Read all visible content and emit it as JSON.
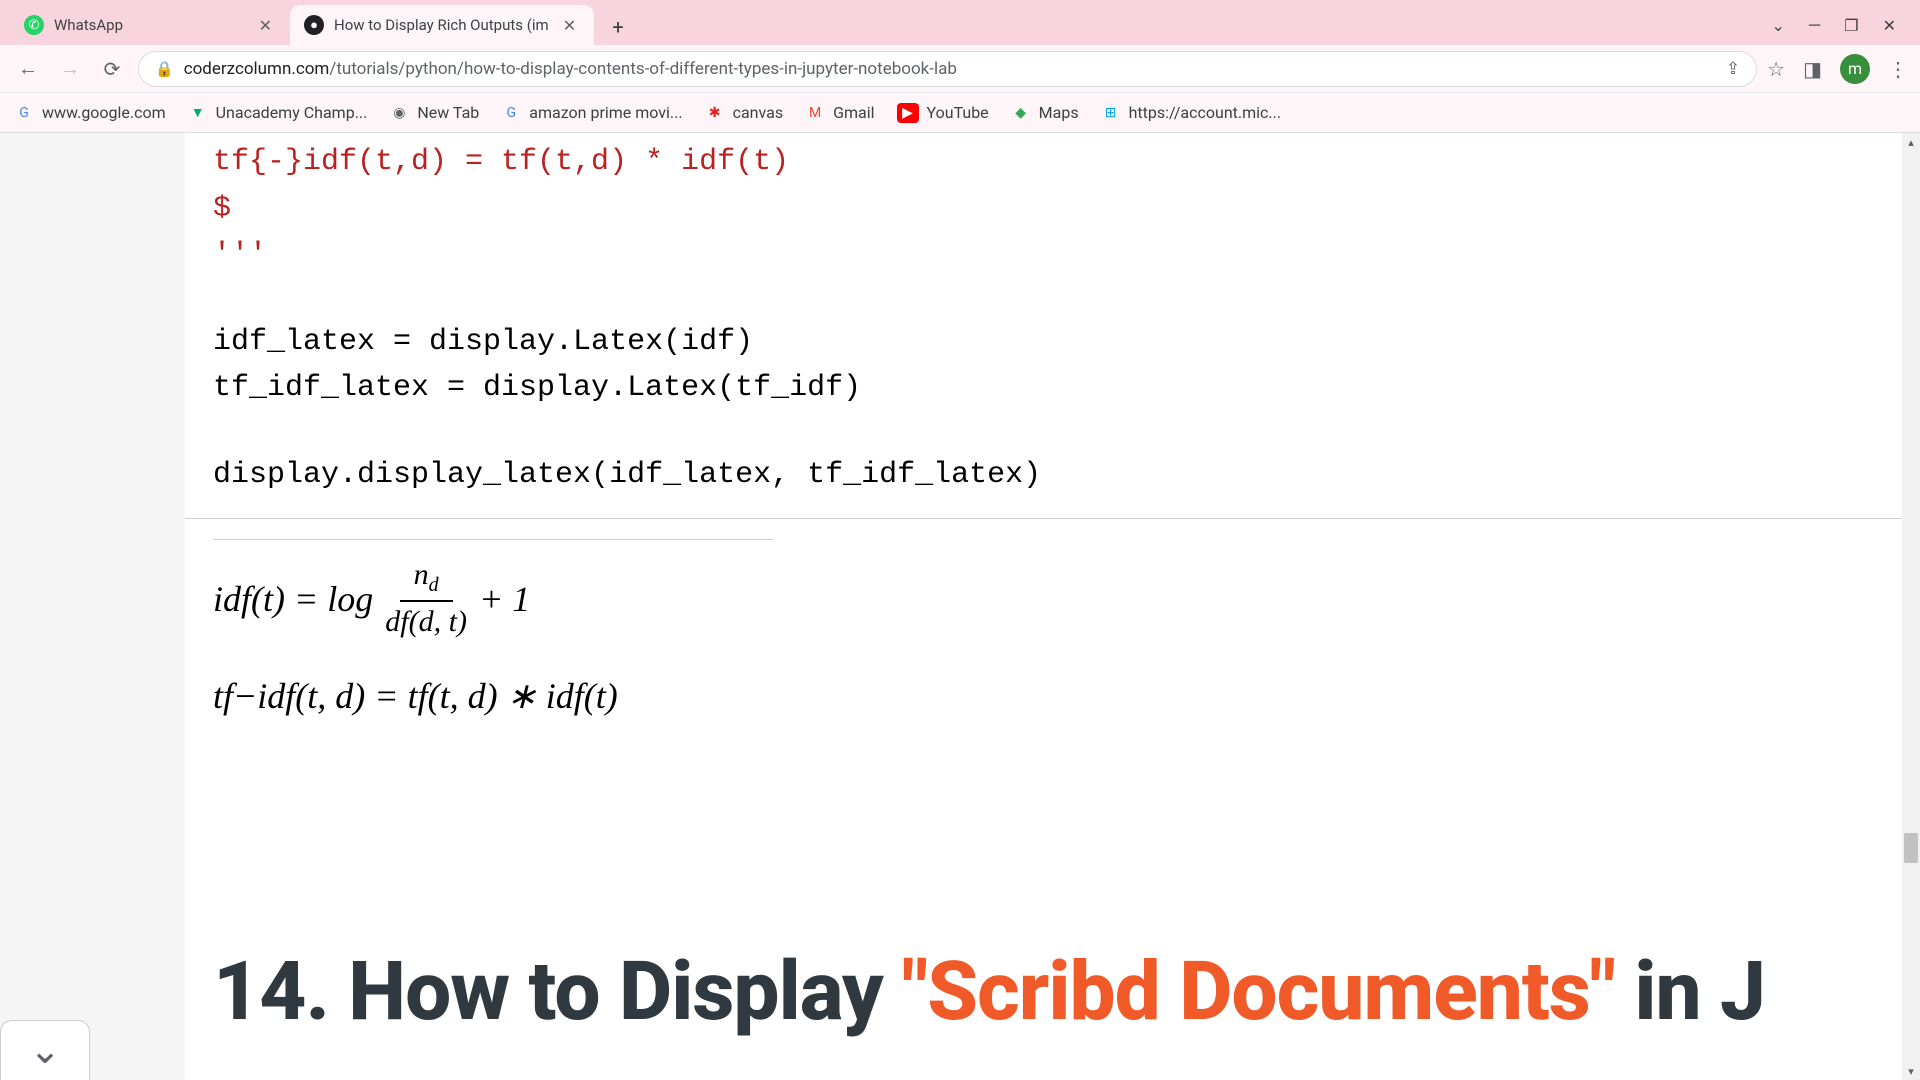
{
  "tabs": [
    {
      "title": "WhatsApp",
      "favicon": "wa"
    },
    {
      "title": "How to Display Rich Outputs (im",
      "favicon": "dark"
    }
  ],
  "url": {
    "domain": "coderzcolumn.com",
    "path": "/tutorials/python/how-to-display-contents-of-different-types-in-jupyter-notebook-lab"
  },
  "avatar_letter": "m",
  "bookmarks": [
    {
      "label": "www.google.com",
      "icon": "G",
      "color": "#4285f4"
    },
    {
      "label": "Unacademy Champ...",
      "icon": "▼",
      "color": "#0a7"
    },
    {
      "label": "New Tab",
      "icon": "◉",
      "color": "#5f6368"
    },
    {
      "label": "amazon prime movi...",
      "icon": "G",
      "color": "#4285f4"
    },
    {
      "label": "canvas",
      "icon": "✱",
      "color": "#e2231a"
    },
    {
      "label": "Gmail",
      "icon": "M",
      "color": "#ea4335"
    },
    {
      "label": "YouTube",
      "icon": "▶",
      "color": "#ff0000"
    },
    {
      "label": "Maps",
      "icon": "◆",
      "color": "#34a853"
    },
    {
      "label": "https://account.mic...",
      "icon": "⊞",
      "color": "#00a4ef"
    }
  ],
  "code": {
    "line1": "tf{-}idf(t,d) = tf(t,d) * idf(t)",
    "line2": "$",
    "line3": "'''",
    "line4": "idf_latex = display.Latex(idf)",
    "line5": "tf_idf_latex = display.Latex(tf_idf)",
    "line6": "display.display_latex(idf_latex, tf_idf_latex)"
  },
  "formula": {
    "idf_lhs": "idf(t) = log",
    "frac_num_n": "n",
    "frac_num_sub": "d",
    "frac_den": "df(d, t)",
    "idf_rhs": "+ 1",
    "tfidf": "tf−idf(t, d) = tf(t, d) ∗ idf(t)"
  },
  "heading": {
    "prefix": "14. How to Display ",
    "highlight": "\"Scribd Documents\"",
    "suffix": " in J"
  }
}
